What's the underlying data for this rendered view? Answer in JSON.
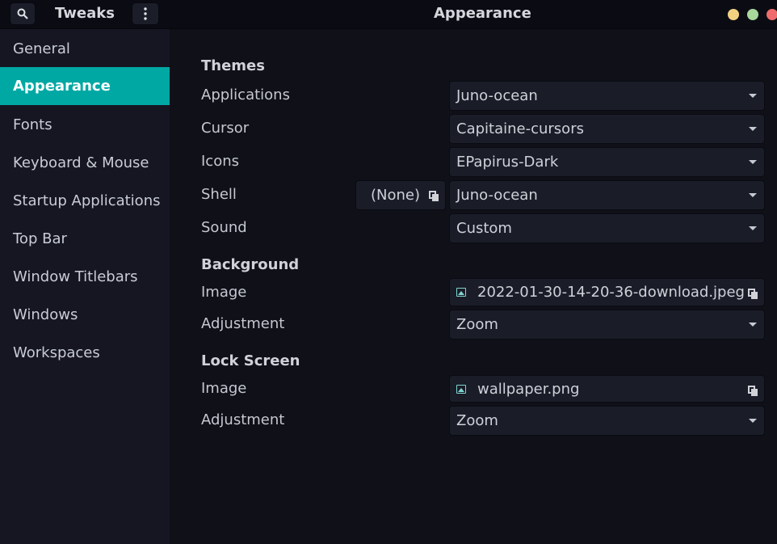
{
  "header": {
    "app_title": "Tweaks",
    "page_title": "Appearance",
    "icons": {
      "search": "search-icon",
      "menu": "vertical-dots-icon"
    },
    "window_controls": {
      "minimize_color": "#f2d282",
      "maximize_color": "#a8d89a",
      "close_color": "#ee6c6c"
    }
  },
  "sidebar": {
    "accent_color": "#00a8a4",
    "items": [
      {
        "label": "General",
        "active": false
      },
      {
        "label": "Appearance",
        "active": true
      },
      {
        "label": "Fonts",
        "active": false
      },
      {
        "label": "Keyboard & Mouse",
        "active": false
      },
      {
        "label": "Startup Applications",
        "active": false
      },
      {
        "label": "Top Bar",
        "active": false
      },
      {
        "label": "Window Titlebars",
        "active": false
      },
      {
        "label": "Windows",
        "active": false
      },
      {
        "label": "Workspaces",
        "active": false
      }
    ]
  },
  "themes": {
    "title": "Themes",
    "applications": {
      "label": "Applications",
      "value": "Juno-ocean"
    },
    "cursor": {
      "label": "Cursor",
      "value": "Capitaine-cursors"
    },
    "icons": {
      "label": "Icons",
      "value": "EPapirus-Dark"
    },
    "shell": {
      "label": "Shell",
      "file_button": "(None)",
      "value": "Juno-ocean"
    },
    "sound": {
      "label": "Sound",
      "value": "Custom"
    }
  },
  "background": {
    "title": "Background",
    "image": {
      "label": "Image",
      "value": "2022-01-30-14-20-36-download.jpeg"
    },
    "adjustment": {
      "label": "Adjustment",
      "value": "Zoom"
    }
  },
  "lock_screen": {
    "title": "Lock Screen",
    "image": {
      "label": "Image",
      "value": "wallpaper.png"
    },
    "adjustment": {
      "label": "Adjustment",
      "value": "Zoom"
    }
  }
}
